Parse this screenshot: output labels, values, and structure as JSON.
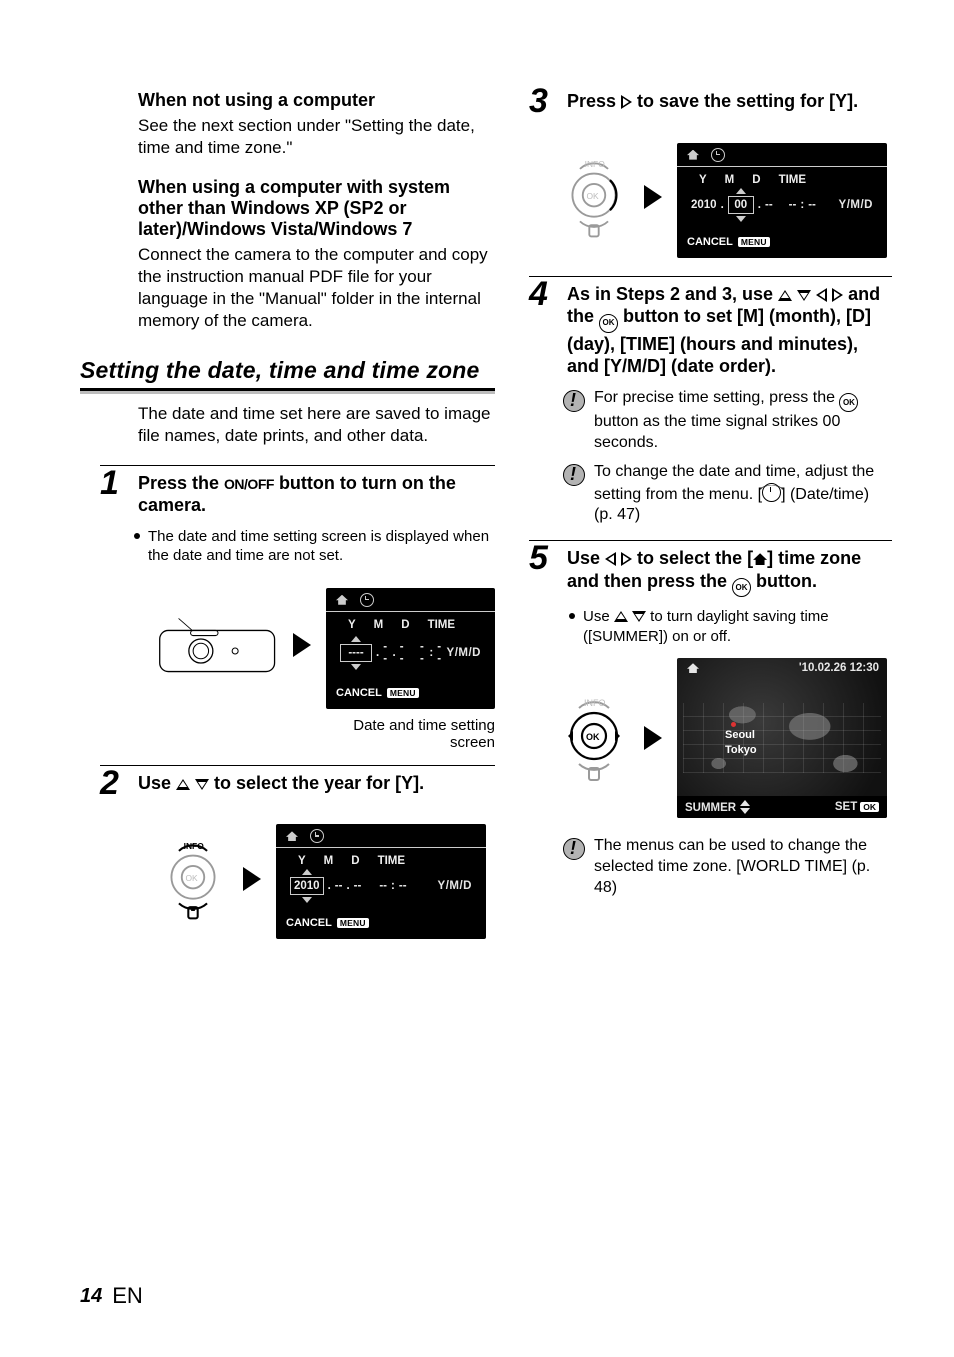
{
  "left": {
    "h1": "When not using a computer",
    "p1": "See the next section under \"Setting the date, time and time zone.\"",
    "h2": "When using a computer with system other than Windows XP (SP2 or later)/Windows Vista/Windows 7",
    "p2": "Connect the camera to the computer and copy the instruction manual PDF file for your language in the \"Manual\" folder in the internal memory of the camera.",
    "section": "Setting the date, time and time zone",
    "intro": "The date and time set here are saved to image file names, date prints, and other data.",
    "step1_pre": "Press the ",
    "step1_btn": "ON/OFF",
    "step1_post": " button to turn on the camera.",
    "step1_sub": "The date and time setting screen is displayed when the date and time are not set.",
    "fig1_caption": "Date and time setting screen",
    "step2_pre": "Use ",
    "step2_post": " to select the year for [Y]."
  },
  "right": {
    "step3_pre": "Press ",
    "step3_post": " to save the setting for [Y].",
    "step4_pre": "As in Steps 2 and 3, use ",
    "step4_mid": " and the ",
    "step4_post": " button to set [M] (month), [D] (day), [TIME] (hours and minutes), and [Y/M/D] (date order).",
    "note1_pre": "For precise time setting, press the ",
    "note1_post": " button as the time signal strikes 00 seconds.",
    "note2": "To change the date and time, adjust the setting from the menu. [",
    "note2_post": "] (Date/time) (p. 47)",
    "step5_pre": "Use ",
    "step5_mid": " to select the [",
    "step5_post": "] time zone and then press the ",
    "step5_end": " button.",
    "step5_sub_pre": "Use ",
    "step5_sub_post": " to turn daylight saving time ([SUMMER]) on or off.",
    "note3": "The menus can be used to change the selected time zone. [WORLD TIME] (p. 48)"
  },
  "screens": {
    "common": {
      "Y": "Y",
      "M": "M",
      "D": "D",
      "TIME": "TIME",
      "YMD": "Y/M/D",
      "CANCEL": "CANCEL",
      "MENU": "MENU",
      "dashes4": "----",
      "dash2": "--",
      "dot": ".",
      "colon": ":",
      "val2010": "2010",
      "val00": "00"
    },
    "map": {
      "timestamp": "'10.02.26 12:30",
      "city1": "Seoul",
      "city2": "Tokyo",
      "SUMMER": "SUMMER",
      "SET": "SET",
      "OK": "OK"
    }
  },
  "footer": {
    "page": "14",
    "lang": "EN"
  }
}
